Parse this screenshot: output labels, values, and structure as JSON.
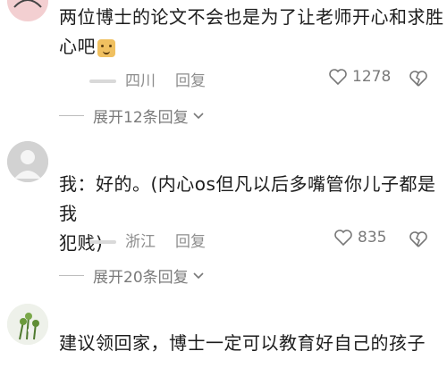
{
  "comments": [
    {
      "text_lines": [
        "两位博士的论文不会也是为了让老师开心和求胜",
        "心吧"
      ],
      "location": "四川",
      "reply_label": "回复",
      "likes": "1278",
      "expand_label": "展开12条回复",
      "avatar": "pink-avatar"
    },
    {
      "text_lines": [
        "我：好的。(内心os但凡以后多嘴管你儿子都是我",
        "犯贱)"
      ],
      "location": "浙江",
      "reply_label": "回复",
      "likes": "835",
      "expand_label": "展开20条回复",
      "avatar": "default-gray-avatar"
    },
    {
      "text_lines": [
        "建议领回家，博士一定可以教育好自己的孩子"
      ],
      "location": "",
      "likes": "",
      "avatar": "plant-photo-avatar"
    }
  ],
  "icons": {
    "like": "heart-outline-icon",
    "dislike": "broken-heart-icon",
    "expand": "chevron-down-icon"
  }
}
